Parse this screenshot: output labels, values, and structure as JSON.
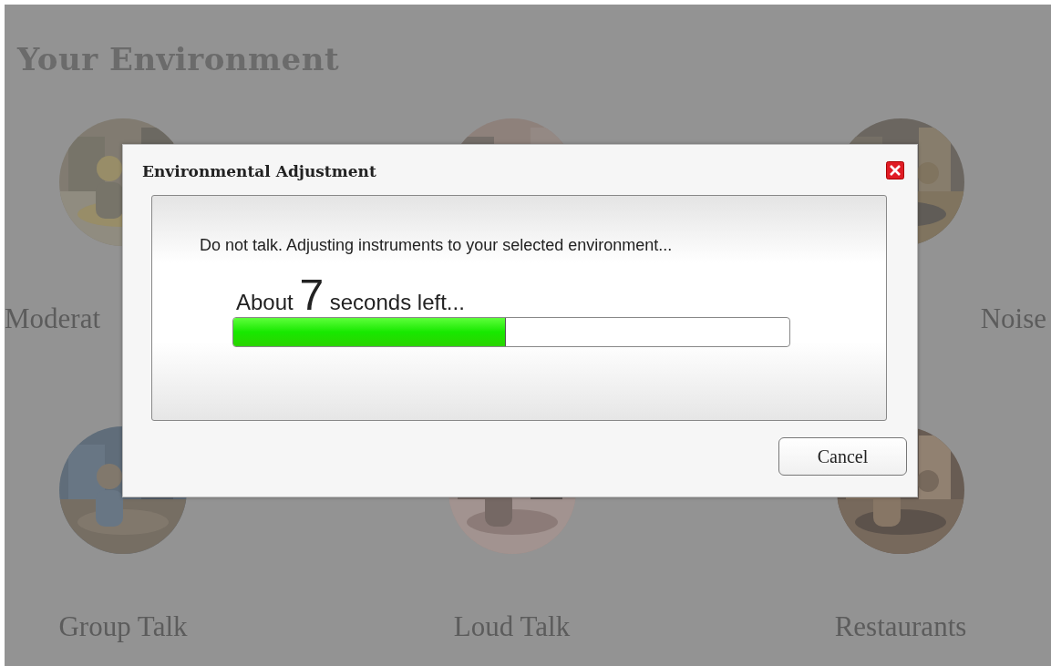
{
  "page": {
    "heading": "Your Environment",
    "environments": [
      {
        "kind": "picture",
        "label": "Moderat"
      },
      {
        "kind": "picture"
      },
      {
        "kind": "picture",
        "label": "Noise"
      },
      {
        "kind": "picture",
        "label": "Group Talk"
      },
      {
        "kind": "picture",
        "label": "Loud Talk"
      },
      {
        "kind": "picture",
        "label": "Restaurants"
      }
    ]
  },
  "dialog": {
    "title": "Environmental Adjustment",
    "message": "Do not talk. Adjusting instruments to your selected environment...",
    "countdown": {
      "prefix": "About",
      "number": "7",
      "suffix": "seconds left..."
    },
    "progress": {
      "level": 0.49
    },
    "buttons": [
      "Cancel"
    ]
  }
}
